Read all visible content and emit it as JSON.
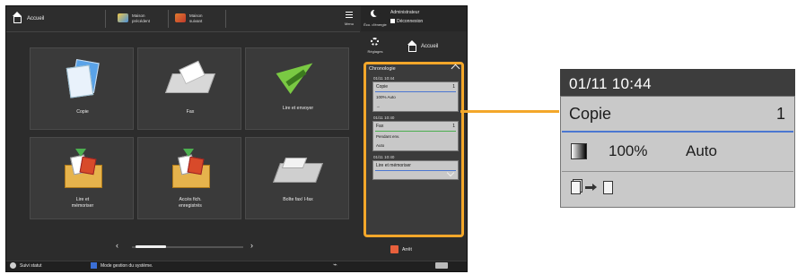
{
  "device": {
    "home_label": "Accueil",
    "shortcuts": [
      {
        "line1": "Maison",
        "line2": "précédent",
        "color": "#d9534f"
      },
      {
        "line1": "Maison",
        "line2": "suivant",
        "color": "#e07b2f"
      }
    ],
    "menu_label": "Menu",
    "sleep_label": "Éco. d'énergie",
    "admin_label": "Administrateur",
    "logout_label": "Déconnexion",
    "settings_label": "Réglages",
    "home_right_label": "Accueil",
    "tiles": [
      {
        "label": "Copie",
        "icon": "copy-icon"
      },
      {
        "label": "Fax",
        "icon": "fax-icon"
      },
      {
        "label": "Lire et envoyer",
        "icon": "scan-send-icon"
      },
      {
        "label": "Lire et mémoriser",
        "icon": "scan-store-icon"
      },
      {
        "label": "Accès fich. enregistrés",
        "icon": "stored-files-icon"
      },
      {
        "label": "Boîte fax/ I-fax",
        "icon": "fax-inbox-icon"
      }
    ],
    "pager_prev": "‹",
    "pager_next": "›",
    "status_label": "Suivi statut",
    "system_mode_label": "Mode gestion du système.",
    "chronology": {
      "title": "Chronologie",
      "jobs": [
        {
          "time": "01/11 10:44",
          "title": "Copie",
          "count": "1",
          "row2": "100%    Auto",
          "row3": "→"
        },
        {
          "time": "01/11 10:40",
          "title": "Fax",
          "count": "1",
          "row2": "Pendant env.",
          "row3": "Auto"
        },
        {
          "time": "01/11 10:40",
          "title": "Lire et mémoriser",
          "count": "",
          "row2": "",
          "row3": ""
        }
      ]
    },
    "stop_label": "Arrêt"
  },
  "zoom": {
    "time": "01/11 10:44",
    "title": "Copie",
    "count": "1",
    "ratio": "100%",
    "mode": "Auto"
  },
  "colors": {
    "highlight": "#f3a72a",
    "accent_line": "#4b77d1",
    "stop": "#e8603c"
  }
}
